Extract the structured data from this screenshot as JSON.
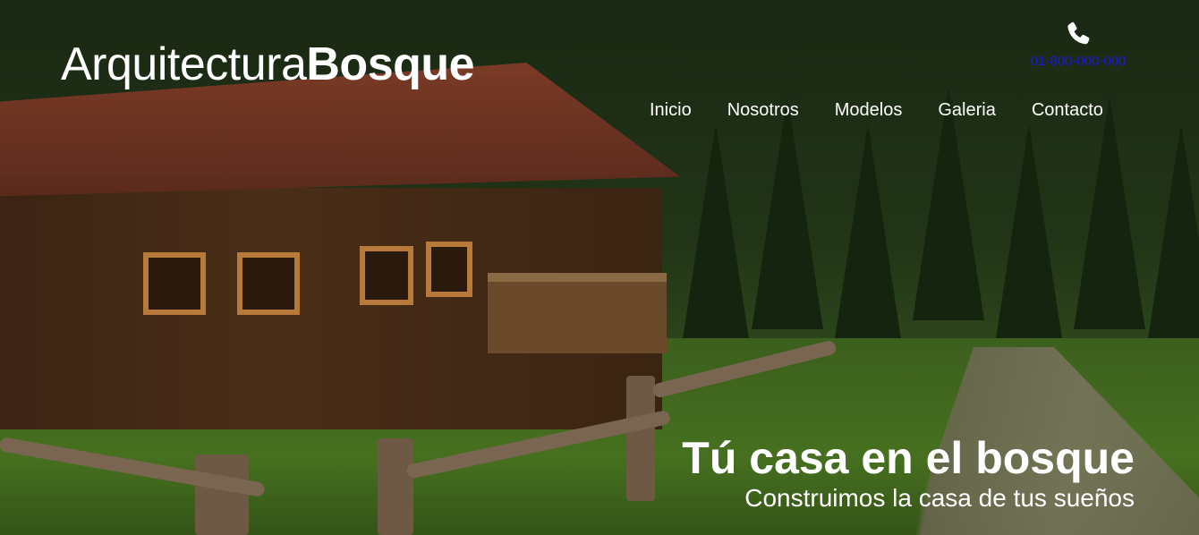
{
  "header": {
    "logo_light": "Arquitectura",
    "logo_bold": "Bosque",
    "phone_icon": "phone-icon",
    "phone_number": "01-800-000-000"
  },
  "nav": {
    "items": [
      {
        "label": "Inicio"
      },
      {
        "label": "Nosotros"
      },
      {
        "label": "Modelos"
      },
      {
        "label": "Galeria"
      },
      {
        "label": "Contacto"
      }
    ]
  },
  "hero": {
    "title": "Tú casa en el bosque",
    "subtitle": "Construimos la casa de tus sueños"
  },
  "colors": {
    "text": "#ffffff",
    "phone_link": "#1a1ad6"
  }
}
